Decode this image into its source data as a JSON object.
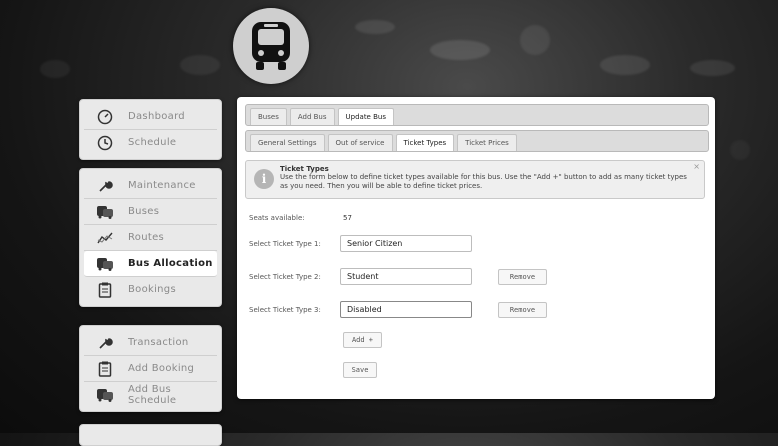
{
  "sidebar": {
    "group1": [
      {
        "label": "Dashboard",
        "icon": "dashboard-gauge-icon"
      },
      {
        "label": "Schedule",
        "icon": "clock-icon"
      }
    ],
    "group2": [
      {
        "label": "Maintenance",
        "icon": "wrench-icon"
      },
      {
        "label": "Buses",
        "icon": "bus-icon"
      },
      {
        "label": "Routes",
        "icon": "routes-chart-icon"
      },
      {
        "label": "Bus Allocation",
        "icon": "bus-icon",
        "active": true
      },
      {
        "label": "Bookings",
        "icon": "clipboard-icon"
      }
    ],
    "group3": [
      {
        "label": "Transaction",
        "icon": "wrench-icon"
      },
      {
        "label": "Add Booking",
        "icon": "clipboard-icon"
      },
      {
        "label": "Add Bus Schedule",
        "icon": "bus-icon"
      }
    ]
  },
  "tabs_main": [
    {
      "label": "Buses"
    },
    {
      "label": "Add Bus"
    },
    {
      "label": "Update Bus",
      "active": true
    }
  ],
  "tabs_sub": [
    {
      "label": "General Settings"
    },
    {
      "label": "Out of service"
    },
    {
      "label": "Ticket Types",
      "active": true
    },
    {
      "label": "Ticket Prices"
    }
  ],
  "info": {
    "title": "Ticket Types",
    "body": "Use the form below to define ticket types available for this bus. Use the \"Add +\" button to add as many ticket types as you need. Then you will be able to define ticket prices.",
    "close": "×"
  },
  "form": {
    "seats_label": "Seats available:",
    "seats_value": "57",
    "rows": [
      {
        "label": "Select Ticket Type 1:",
        "value": "Senior Citizen"
      },
      {
        "label": "Select Ticket Type 2:",
        "value": "Student",
        "remove": "Remove"
      },
      {
        "label": "Select Ticket Type 3:",
        "value": "Disabled",
        "remove": "Remove"
      }
    ],
    "add_label": "Add +",
    "save_label": "Save"
  },
  "colors": {
    "accent_active_tab": "#ffffff",
    "sidebar_bg": "#e9e9e9"
  }
}
